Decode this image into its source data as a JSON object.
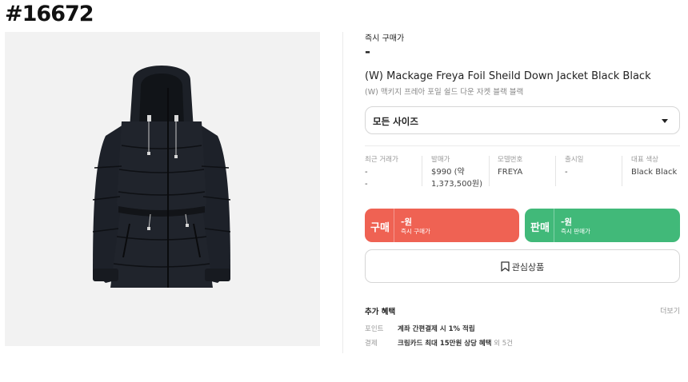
{
  "tag": "#16672",
  "product": {
    "instant_price_label": "즉시 구매가",
    "instant_price_value": "-",
    "title": "(W) Mackage Freya Foil Sheild Down Jacket Black Black",
    "subtitle": "(W) 맥키지 프레아 포일 쉴드 다운 자켓 블랙 블랙",
    "image_icon": "down-jacket-image"
  },
  "size_select": {
    "label": "모든 사이즈",
    "icon": "chevron-down-icon"
  },
  "info": {
    "recent": {
      "label": "최근 거래가",
      "value1": "-",
      "value2": "-"
    },
    "release_price": {
      "label": "발매가",
      "value1": "$990 (약",
      "value2": "1,373,500원)"
    },
    "model": {
      "label": "모델번호",
      "value1": "FREYA"
    },
    "release_date": {
      "label": "출시일",
      "value1": "-"
    },
    "color": {
      "label": "대표 색상",
      "value1": "Black Black"
    }
  },
  "buy": {
    "title": "구매",
    "price": "-원",
    "sub": "즉시 구매가",
    "color": "#ef6253"
  },
  "sell": {
    "title": "판매",
    "price": "-원",
    "sub": "즉시 판매가",
    "color": "#41b979"
  },
  "wishlist": {
    "label": "관심상품",
    "icon": "bookmark-icon"
  },
  "benefits": {
    "title": "추가 혜택",
    "more": "더보기",
    "rows": [
      {
        "label": "포인트",
        "text": "계좌 간편결제 시 1% 적립",
        "extra": ""
      },
      {
        "label": "결제",
        "text": "크림카드 최대 15만원 상당 혜택",
        "extra": " 외 5건"
      }
    ]
  }
}
